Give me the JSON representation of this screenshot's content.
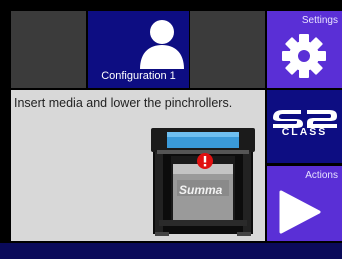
{
  "tiles": {
    "config_label": "Configuration 1",
    "settings_label": "Settings",
    "actions_label": "Actions",
    "brand_s2": "S2",
    "brand_class": "CLASS"
  },
  "message": {
    "text": "Insert media and lower the pinchrollers.",
    "device_brand": "Summa",
    "alert_icon": "alert-icon"
  },
  "icons": {
    "user": "user-icon",
    "gear": "gear-icon",
    "play": "play-icon"
  },
  "colors": {
    "tile_blue": "#0d0d82",
    "tile_purple": "#5a2fd6",
    "tile_dark": "#3b3b3b",
    "alert_red": "#e01010"
  }
}
